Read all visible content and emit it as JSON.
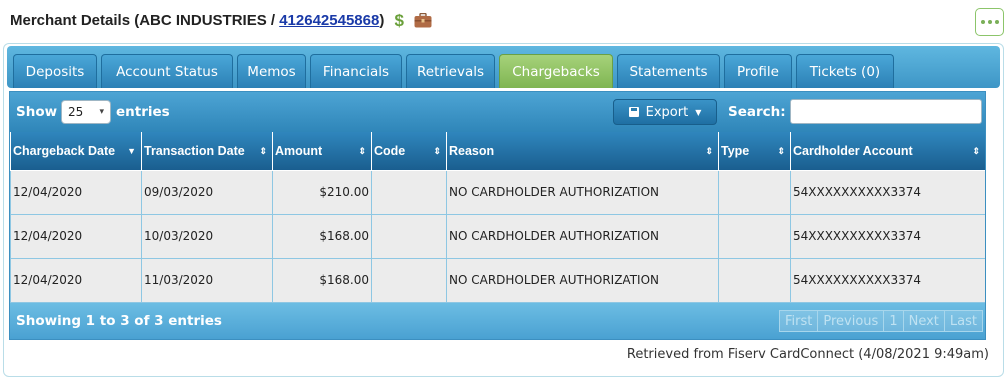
{
  "header": {
    "title_prefix": "Merchant Details (ABC INDUSTRIES / ",
    "merchant_id": "412642545868",
    "title_suffix": ")"
  },
  "tabs": [
    {
      "label": "Deposits",
      "active": false
    },
    {
      "label": "Account Status",
      "active": false
    },
    {
      "label": "Memos",
      "active": false
    },
    {
      "label": "Financials",
      "active": false
    },
    {
      "label": "Retrievals",
      "active": false
    },
    {
      "label": "Chargebacks",
      "active": true
    },
    {
      "label": "Statements",
      "active": false
    },
    {
      "label": "Profile",
      "active": false
    },
    {
      "label": "Tickets (0)",
      "active": false
    }
  ],
  "toolbar": {
    "show_label": "Show",
    "length_value": "25",
    "entries_label": "entries",
    "export_label": "Export",
    "search_label": "Search:",
    "search_value": ""
  },
  "columns": [
    {
      "label": "Chargeback Date",
      "sort": "desc"
    },
    {
      "label": "Transaction Date",
      "sort": "both"
    },
    {
      "label": "Amount",
      "sort": "both"
    },
    {
      "label": "Code",
      "sort": "both"
    },
    {
      "label": "Reason",
      "sort": "both"
    },
    {
      "label": "Type",
      "sort": "both"
    },
    {
      "label": "Cardholder Account",
      "sort": "both"
    }
  ],
  "rows": [
    [
      "12/04/2020",
      "09/03/2020",
      "$210.00",
      "",
      "NO CARDHOLDER AUTHORIZATION",
      "",
      "54XXXXXXXXXX3374"
    ],
    [
      "12/04/2020",
      "10/03/2020",
      "$168.00",
      "",
      "NO CARDHOLDER AUTHORIZATION",
      "",
      "54XXXXXXXXXX3374"
    ],
    [
      "12/04/2020",
      "11/03/2020",
      "$168.00",
      "",
      "NO CARDHOLDER AUTHORIZATION",
      "",
      "54XXXXXXXXXX3374"
    ]
  ],
  "footer": {
    "info": "Showing 1 to 3 of 3 entries",
    "pager": [
      "First",
      "Previous",
      "1",
      "Next",
      "Last"
    ]
  },
  "retrieved": "Retrieved from Fiserv CardConnect (4/08/2021 9:49am)",
  "icons": {
    "dollar": "dollar-icon",
    "briefcase": "briefcase-icon",
    "more": "more-dots-icon",
    "export": "save-icon",
    "sort": "sort-icon"
  },
  "colors": {
    "tab_active": "#8cc263",
    "tab": "#3a93c7",
    "header_bar": "#2577aa",
    "link": "#1a3aa8",
    "dollar": "#6aa03a"
  }
}
